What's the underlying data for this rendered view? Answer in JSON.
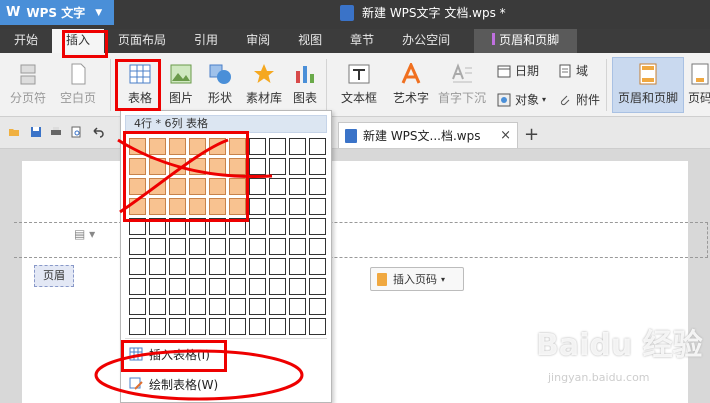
{
  "app": {
    "name": "WPS 文字",
    "logo": "W",
    "caret": "▼"
  },
  "window": {
    "title": "新建 WPS文字 文档.wps *"
  },
  "menu": {
    "tabs": [
      {
        "label": "开始"
      },
      {
        "label": "插入"
      },
      {
        "label": "页面布局"
      },
      {
        "label": "引用"
      },
      {
        "label": "审阅"
      },
      {
        "label": "视图"
      },
      {
        "label": "章节"
      },
      {
        "label": "办公空间"
      },
      {
        "label": "页眉和页脚"
      }
    ]
  },
  "ribbon": {
    "page_break": "分页符",
    "blank_page": "空白页",
    "table": "表格",
    "picture": "图片",
    "shape": "形状",
    "material": "素材库",
    "chart": "图表",
    "textbox": "文本框",
    "wordart": "艺术字",
    "drop_cap": "首字下沉",
    "date": "日期",
    "field": "域",
    "object": "对象",
    "attachment": "附件",
    "header_footer": "页眉和页脚",
    "more": "页码"
  },
  "tabs": {
    "doc_tab": "新建 WPS文...档.wps",
    "close": "×",
    "new": "+"
  },
  "dropdown": {
    "size_label": "4行 * 6列 表格",
    "rows": 10,
    "cols": 10,
    "selected_rows": 4,
    "selected_cols": 6,
    "insert_table": "插入表格(I)",
    "draw_table": "绘制表格(W)"
  },
  "document": {
    "header_label": "页眉",
    "insert_page_number": "插入页码"
  },
  "watermark": {
    "brand": "Baidu 经验",
    "url": "jingyan.baidu.com"
  },
  "colors": {
    "accent": "#4a8fd8",
    "annotation": "#ee0000",
    "selected_cell": "#f8c290"
  }
}
